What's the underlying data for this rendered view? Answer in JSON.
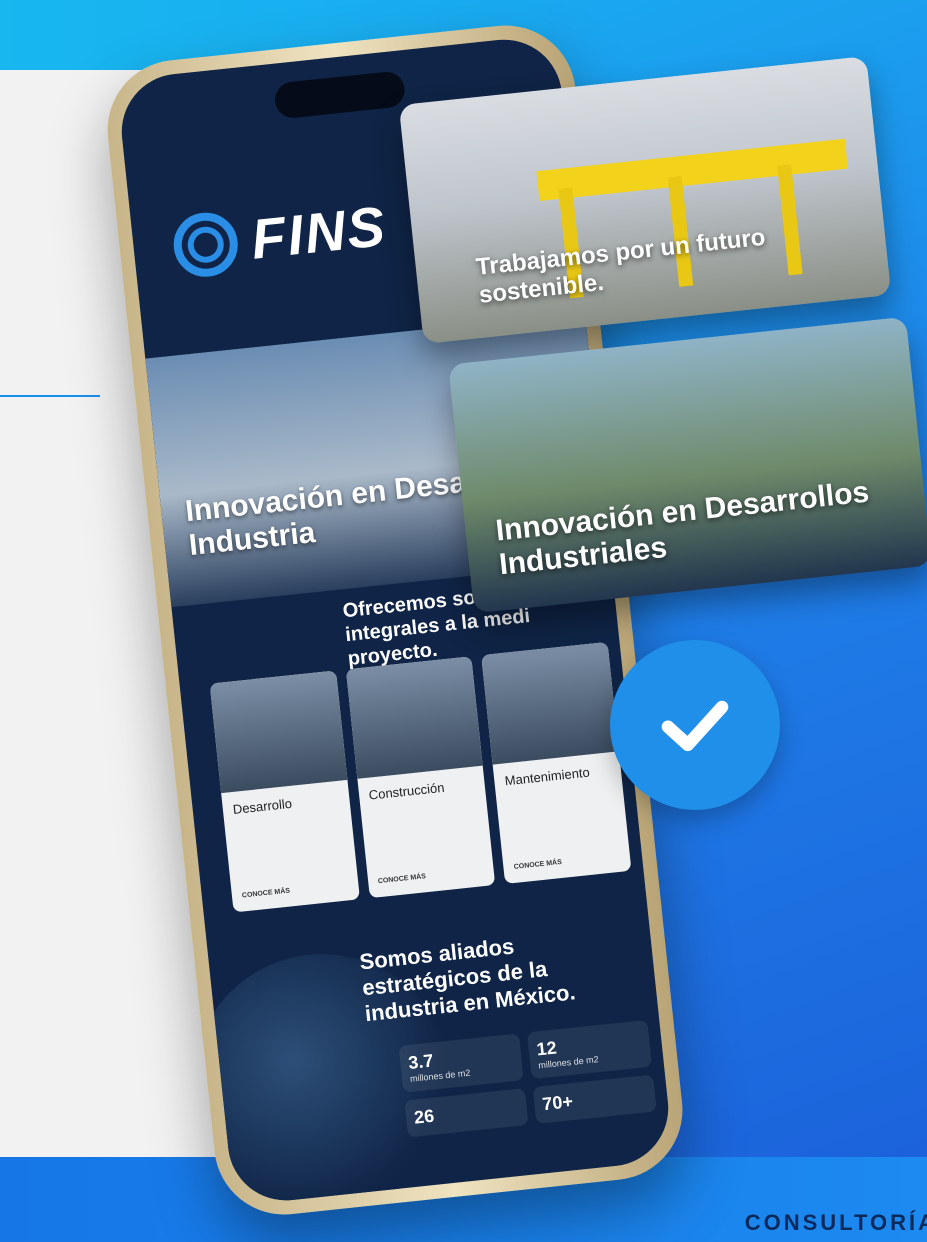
{
  "logo": {
    "text": "FINS"
  },
  "panels": {
    "sustain": "Trabajamos por un futuro sostenible.",
    "innovation": "Innovación en Desarrollos Industriales"
  },
  "hero": {
    "title": "Innovación en Desarrollos Industria",
    "subtitle": "Ofrecemos solucio integrales a la medi proyecto."
  },
  "cards": [
    {
      "title": "Desarrollo",
      "more": "CONOCE MÁS"
    },
    {
      "title": "Construcción",
      "more": "CONOCE MÁS"
    },
    {
      "title": "Mantenimiento",
      "more": "CONOCE MÁS"
    }
  ],
  "allies": {
    "title": "Somos aliados estratégicos de la industria en México."
  },
  "stats": [
    {
      "value": "3.7",
      "label": "millones de m2"
    },
    {
      "value": "12",
      "label": "millones de m2"
    },
    {
      "value": "26",
      "label": ""
    },
    {
      "value": "70+",
      "label": ""
    }
  ],
  "footer": {
    "text": "CONSULTORÍA"
  }
}
